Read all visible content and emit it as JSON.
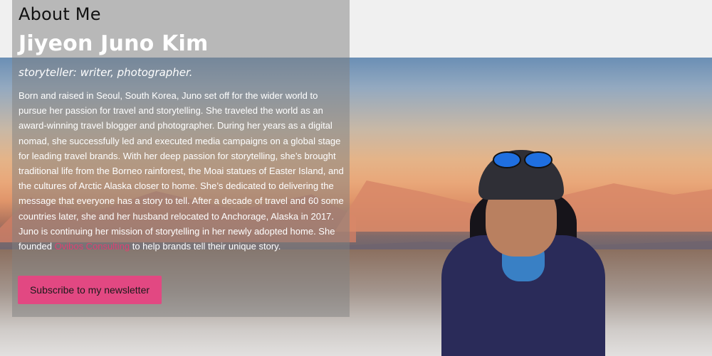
{
  "about": {
    "heading": "About Me",
    "name": "Jiyeon Juno Kim",
    "tagline": "storyteller: writer, photographer.",
    "bio_before_link": "Born and raised in Seoul, South Korea, Juno set off for the wider world to pursue her passion for travel and storytelling. She traveled the world as an award-winning travel blogger and photographer. During her years as a digital nomad, she successfully led and executed media campaigns on a global stage for leading travel brands. With her deep passion for storytelling, she’s brought traditional life from the Borneo rainforest, the Moai statues of Easter Island, and the cultures of Arctic Alaska closer to home. She’s dedicated to delivering the message that everyone has a story to tell. After a decade of travel and 60 some countries later, she and her husband relocated to Anchorage, Alaska in 2017. Juno is continuing her mission of storytelling in her newly adopted home. She founded ",
    "bio_link": "Ovibos Consulting",
    "bio_after_link": " to help brands tell their unique story.",
    "subscribe_label": "Subscribe to my newsletter"
  },
  "colors": {
    "accent": "#e24882",
    "link": "#e0416f",
    "overlay": "rgba(128,128,128,0.5)"
  }
}
